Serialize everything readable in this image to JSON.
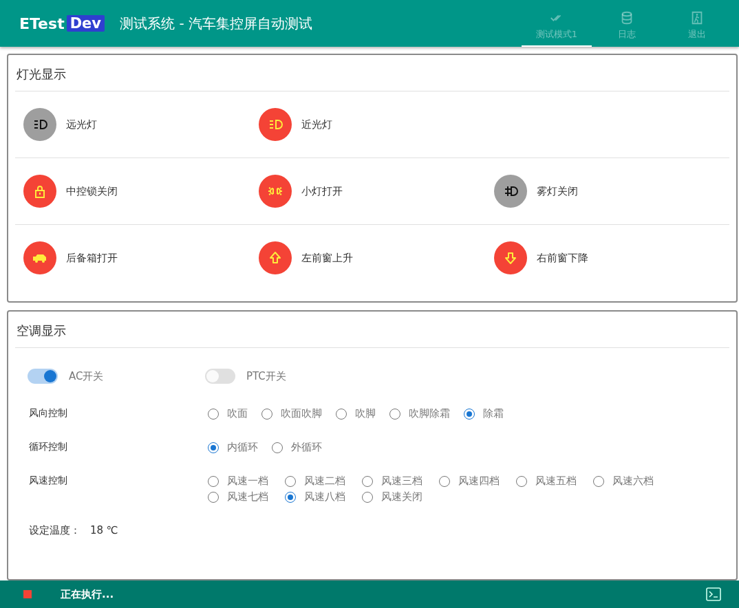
{
  "header": {
    "logo": "ETest",
    "logo_badge": "Dev",
    "title": "测试系统 - 汽车集控屏自动测试",
    "nav": [
      {
        "kind": "check",
        "label": "测试模式1",
        "selected": true
      },
      {
        "kind": "database",
        "label": "日志",
        "selected": false
      },
      {
        "kind": "exit",
        "label": "退出",
        "selected": false
      }
    ]
  },
  "lights": {
    "title": "灯光显示",
    "rows": [
      [
        {
          "kind": "high-beam",
          "label": "远光灯",
          "on": false
        },
        {
          "kind": "low-beam",
          "label": "近光灯",
          "on": true
        }
      ],
      [
        {
          "kind": "lock",
          "label": "中控锁关闭",
          "on": true
        },
        {
          "kind": "parking-light",
          "label": "小灯打开",
          "on": true
        },
        {
          "kind": "fog-light",
          "label": "雾灯关闭",
          "on": false
        }
      ],
      [
        {
          "kind": "car",
          "label": "后备箱打开",
          "on": true
        },
        {
          "kind": "arrow-up",
          "label": "左前窗上升",
          "on": true
        },
        {
          "kind": "arrow-down",
          "label": "右前窗下降",
          "on": true
        }
      ]
    ]
  },
  "climate": {
    "title": "空调显示",
    "switches": [
      {
        "label": "AC开关",
        "on": true
      },
      {
        "label": "PTC开关",
        "on": false
      }
    ],
    "groups": [
      {
        "label": "风向控制",
        "options": [
          {
            "label": "吹面",
            "selected": false
          },
          {
            "label": "吹面吹脚",
            "selected": false
          },
          {
            "label": "吹脚",
            "selected": false
          },
          {
            "label": "吹脚除霜",
            "selected": false
          },
          {
            "label": "除霜",
            "selected": true
          }
        ]
      },
      {
        "label": "循环控制",
        "options": [
          {
            "label": "内循环",
            "selected": true
          },
          {
            "label": "外循环",
            "selected": false
          }
        ]
      },
      {
        "label": "风速控制",
        "kind": "grid",
        "options": [
          {
            "label": "风速一档",
            "selected": false
          },
          {
            "label": "风速二档",
            "selected": false
          },
          {
            "label": "风速三档",
            "selected": false
          },
          {
            "label": "风速四档",
            "selected": false
          },
          {
            "label": "风速五档",
            "selected": false
          },
          {
            "label": "风速六档",
            "selected": false
          },
          {
            "label": "风速七档",
            "selected": false
          },
          {
            "label": "风速八档",
            "selected": true
          },
          {
            "label": "风速关闭",
            "selected": false
          }
        ]
      }
    ],
    "temperature": {
      "label": "设定温度：",
      "value": "18 ℃"
    }
  },
  "status_bar": {
    "text": "正在执行..."
  }
}
